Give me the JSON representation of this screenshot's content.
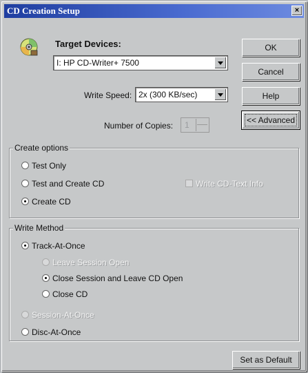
{
  "window": {
    "title": "CD Creation Setup",
    "close_glyph": "×"
  },
  "icon": {
    "name": "cd-disc-icon"
  },
  "target": {
    "label": "Target Devices:",
    "device_value": "I: HP CD-Writer+ 7500",
    "write_speed_label": "Write Speed:",
    "write_speed_value": "2x (300 KB/sec)",
    "copies_label": "Number of Copies:",
    "copies_value": "1"
  },
  "buttons": {
    "ok": "OK",
    "cancel": "Cancel",
    "help": "Help",
    "advanced": "<< Advanced",
    "set_default": "Set as Default"
  },
  "create_options": {
    "title": "Create options",
    "test_only": "Test Only",
    "test_and_create": "Test and Create CD",
    "create_cd": "Create CD",
    "write_cd_text": "Write CD-Text Info",
    "selected": "create_cd"
  },
  "write_method": {
    "title": "Write Method",
    "track_at_once": "Track-At-Once",
    "leave_session_open": "Leave Session Open",
    "close_session_leave_open": "Close Session and Leave CD Open",
    "close_cd": "Close CD",
    "session_at_once": "Session-At-Once",
    "disc_at_once": "Disc-At-Once",
    "selected_method": "track_at_once",
    "selected_sub": "close_session_leave_open"
  }
}
